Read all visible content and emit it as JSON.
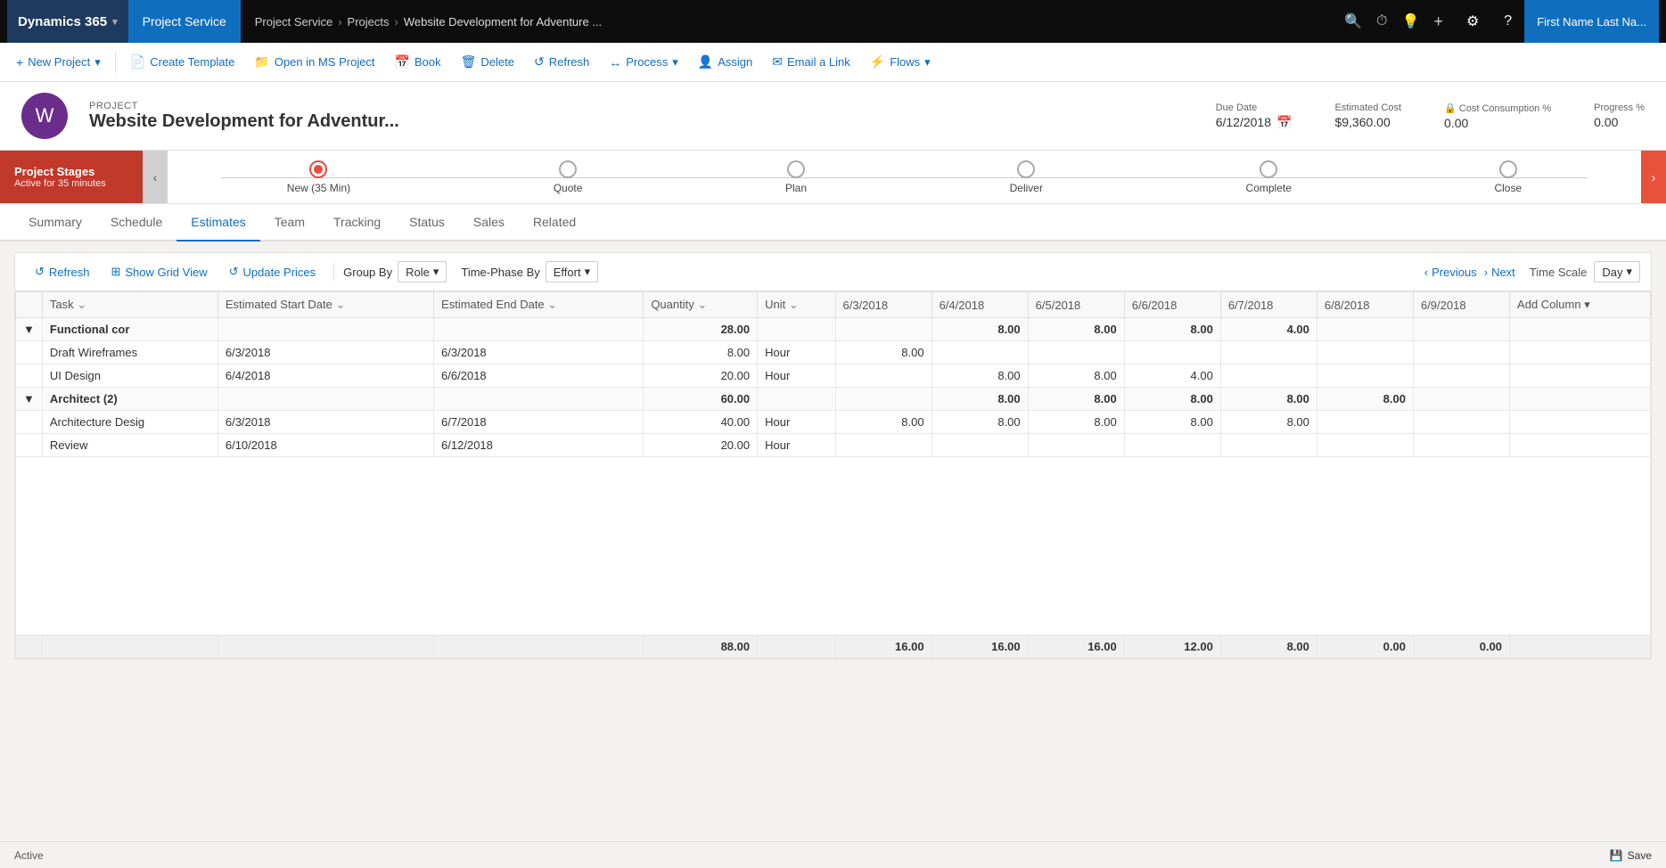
{
  "topNav": {
    "brand": "Dynamics 365",
    "brandChevron": "▾",
    "appName": "Project Service",
    "breadcrumbs": [
      "Project Service",
      "Projects",
      "Website Development for Adventure ..."
    ],
    "breadcrumbSeps": [
      ">",
      ">"
    ],
    "userLabel": "First Name Last Na...",
    "icons": {
      "search": "🔍",
      "recent": "⏱",
      "help": "?",
      "plus": "+",
      "settings": "⚙",
      "question": "?"
    }
  },
  "toolbar": {
    "buttons": [
      {
        "label": "New Project",
        "icon": "+",
        "hasDropdown": true
      },
      {
        "label": "Create Template",
        "icon": "📄",
        "hasDropdown": false
      },
      {
        "label": "Open in MS Project",
        "icon": "📁",
        "hasDropdown": false
      },
      {
        "label": "Book",
        "icon": "📅",
        "hasDropdown": false
      },
      {
        "label": "Delete",
        "icon": "🗑",
        "hasDropdown": false
      },
      {
        "label": "Refresh",
        "icon": "↺",
        "hasDropdown": false
      },
      {
        "label": "Process",
        "icon": "↔",
        "hasDropdown": true
      },
      {
        "label": "Assign",
        "icon": "👤",
        "hasDropdown": false
      },
      {
        "label": "Email a Link",
        "icon": "✉",
        "hasDropdown": false
      },
      {
        "label": "Flows",
        "icon": "⚡",
        "hasDropdown": true
      }
    ]
  },
  "project": {
    "label": "PROJECT",
    "name": "Website Development for Adventur...",
    "iconLetter": "W",
    "dueDate": {
      "label": "Due Date",
      "value": "6/12/2018",
      "calIcon": "📅"
    },
    "estimatedCost": {
      "label": "Estimated Cost",
      "value": "$9,360.00"
    },
    "costConsumption": {
      "label": "Cost Consumption %",
      "lockIcon": "🔒",
      "value": "0.00"
    },
    "progress": {
      "label": "Progress %",
      "value": "0.00"
    }
  },
  "stages": {
    "labelTitle": "Project Stages",
    "labelSub": "Active for 35 minutes",
    "leftNavIcon": "‹",
    "rightNavIcon": "›",
    "nodes": [
      {
        "label": "New (35 Min)",
        "active": true
      },
      {
        "label": "Quote",
        "active": false
      },
      {
        "label": "Plan",
        "active": false
      },
      {
        "label": "Deliver",
        "active": false
      },
      {
        "label": "Complete",
        "active": false
      },
      {
        "label": "Close",
        "active": false
      }
    ]
  },
  "tabs": {
    "items": [
      {
        "label": "Summary",
        "active": false
      },
      {
        "label": "Schedule",
        "active": false
      },
      {
        "label": "Estimates",
        "active": true
      },
      {
        "label": "Team",
        "active": false
      },
      {
        "label": "Tracking",
        "active": false
      },
      {
        "label": "Status",
        "active": false
      },
      {
        "label": "Sales",
        "active": false
      },
      {
        "label": "Related",
        "active": false
      }
    ]
  },
  "estimatesToolbar": {
    "refreshLabel": "Refresh",
    "showGridLabel": "Show Grid View",
    "updatePricesLabel": "Update Prices",
    "groupByLabel": "Group By",
    "groupByValue": "Role",
    "timePhaseLabel": "Time-Phase By",
    "timePhaseValue": "Effort",
    "previousLabel": "Previous",
    "nextLabel": "Next",
    "timeScaleLabel": "Time Scale",
    "timeScaleValue": "Day"
  },
  "grid": {
    "columns": [
      {
        "key": "expand",
        "label": ""
      },
      {
        "key": "task",
        "label": "Task"
      },
      {
        "key": "startDate",
        "label": "Estimated Start Date"
      },
      {
        "key": "endDate",
        "label": "Estimated End Date"
      },
      {
        "key": "quantity",
        "label": "Quantity"
      },
      {
        "key": "unit",
        "label": "Unit"
      },
      {
        "key": "d603",
        "label": "6/3/2018"
      },
      {
        "key": "d604",
        "label": "6/4/2018"
      },
      {
        "key": "d605",
        "label": "6/5/2018"
      },
      {
        "key": "d606",
        "label": "6/6/2018"
      },
      {
        "key": "d607",
        "label": "6/7/2018"
      },
      {
        "key": "d608",
        "label": "6/8/2018"
      },
      {
        "key": "d609",
        "label": "6/9/2018"
      },
      {
        "key": "addCol",
        "label": "Add Column"
      }
    ],
    "rows": [
      {
        "type": "group",
        "expand": "▼",
        "task": "Functional cor",
        "startDate": "",
        "endDate": "",
        "quantity": "28.00",
        "unit": "",
        "d603": "",
        "d604": "8.00",
        "d605": "8.00",
        "d606": "8.00",
        "d607": "4.00",
        "d608": "",
        "d609": "",
        "addCol": ""
      },
      {
        "type": "task",
        "expand": "",
        "task": "Draft Wireframes",
        "startDate": "6/3/2018",
        "endDate": "6/3/2018",
        "quantity": "8.00",
        "unit": "Hour",
        "d603": "8.00",
        "d604": "",
        "d605": "",
        "d606": "",
        "d607": "",
        "d608": "",
        "d609": "",
        "addCol": ""
      },
      {
        "type": "task",
        "expand": "",
        "task": "UI Design",
        "startDate": "6/4/2018",
        "endDate": "6/6/2018",
        "quantity": "20.00",
        "unit": "Hour",
        "d603": "",
        "d604": "8.00",
        "d605": "8.00",
        "d606": "4.00",
        "d607": "",
        "d608": "",
        "d609": "",
        "addCol": ""
      },
      {
        "type": "group",
        "expand": "▼",
        "task": "Architect (2)",
        "startDate": "",
        "endDate": "",
        "quantity": "60.00",
        "unit": "",
        "d603": "",
        "d604": "8.00",
        "d605": "8.00",
        "d606": "8.00",
        "d607": "8.00",
        "d608": "8.00",
        "d609": "",
        "addCol": ""
      },
      {
        "type": "task",
        "expand": "",
        "task": "Architecture Desig",
        "startDate": "6/3/2018",
        "endDate": "6/7/2018",
        "quantity": "40.00",
        "unit": "Hour",
        "d603": "8.00",
        "d604": "8.00",
        "d605": "8.00",
        "d606": "8.00",
        "d607": "8.00",
        "d608": "",
        "d609": "",
        "addCol": ""
      },
      {
        "type": "task",
        "expand": "",
        "task": "Review",
        "startDate": "6/10/2018",
        "endDate": "6/12/2018",
        "quantity": "20.00",
        "unit": "Hour",
        "d603": "",
        "d604": "",
        "d605": "",
        "d606": "",
        "d607": "",
        "d608": "",
        "d609": "",
        "addCol": ""
      }
    ],
    "footer": {
      "task": "",
      "startDate": "",
      "endDate": "",
      "quantity": "88.00",
      "unit": "",
      "d603": "16.00",
      "d604": "16.00",
      "d605": "16.00",
      "d606": "12.00",
      "d607": "8.00",
      "d608": "0.00",
      "d609": "0.00",
      "addCol": ""
    }
  },
  "statusBar": {
    "statusText": "Active",
    "saveLabel": "Save",
    "saveIcon": "💾"
  }
}
